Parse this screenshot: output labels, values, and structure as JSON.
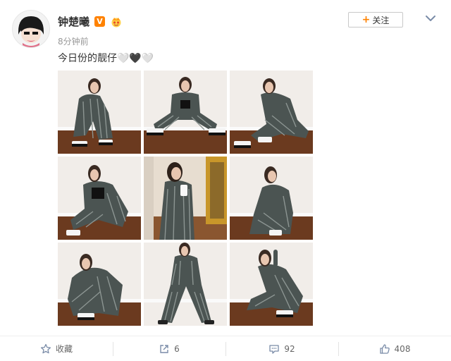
{
  "post": {
    "username": "钟楚曦",
    "verified_badge": "V",
    "time": "8分钟前",
    "content": "今日份的靓仔🤍🖤🤍",
    "follow_label": "关注",
    "follow_plus": "+",
    "photos": [
      {
        "index": 1,
        "pose": "seated-knee-up"
      },
      {
        "index": 2,
        "pose": "seated-floor-wide"
      },
      {
        "index": 3,
        "pose": "seated-leaning"
      },
      {
        "index": 4,
        "pose": "seated-crouch"
      },
      {
        "index": 5,
        "pose": "mirror-selfie"
      },
      {
        "index": 6,
        "pose": "kneeling-side"
      },
      {
        "index": 7,
        "pose": "crouch-front"
      },
      {
        "index": 8,
        "pose": "standing-wide"
      },
      {
        "index": 9,
        "pose": "seated-hand-head"
      }
    ]
  },
  "actions": {
    "favorite_label": "收藏",
    "repost_count": "6",
    "comment_count": "92",
    "like_count": "408"
  },
  "colors": {
    "accent": "#ff8200",
    "text_muted": "#999999",
    "outfit": "#4a5250"
  },
  "icons": [
    "avatar-cartoon",
    "crown-icon",
    "chevron-down-icon",
    "star-icon",
    "repost-icon",
    "comment-icon",
    "like-icon"
  ]
}
